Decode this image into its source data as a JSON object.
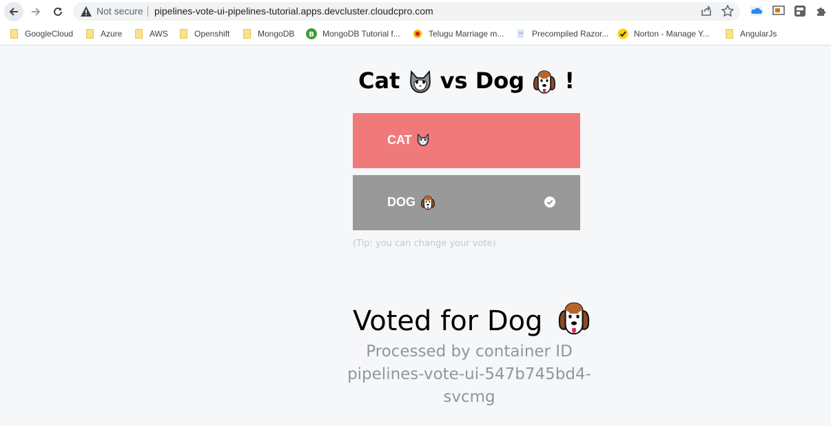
{
  "browser": {
    "security_label": "Not secure",
    "url": "pipelines-vote-ui-pipelines-tutorial.apps.devcluster.cloudcpro.com",
    "icons": [
      "back-arrow-icon",
      "forward-arrow-icon",
      "reload-icon",
      "warning-triangle-icon",
      "share-icon",
      "star-icon",
      "onedrive-icon",
      "cast-icon",
      "extension-icon",
      "puzzle-icon"
    ]
  },
  "bookmarks": [
    {
      "label": "GoogleCloud",
      "icon": "folder-icon"
    },
    {
      "label": "Azure",
      "icon": "folder-icon"
    },
    {
      "label": "AWS",
      "icon": "folder-icon"
    },
    {
      "label": "Openshift",
      "icon": "folder-icon"
    },
    {
      "label": "MongoDB",
      "icon": "folder-icon"
    },
    {
      "label": "MongoDB Tutorial f...",
      "icon": "mongodb-icon"
    },
    {
      "label": "Telugu Marriage m...",
      "icon": "site-icon"
    },
    {
      "label": "Precompiled Razor...",
      "icon": "site-icon"
    },
    {
      "label": "Norton - Manage Y...",
      "icon": "norton-icon"
    },
    {
      "label": "AngularJs",
      "icon": "folder-icon"
    }
  ],
  "page": {
    "title_part1": "Cat",
    "title_part2": "vs Dog",
    "title_part3": "!",
    "cat_button_label": "CAT",
    "dog_button_label": "DOG",
    "selected_option": "dog",
    "tip": "(Tip: you can change your vote)",
    "voted_text": "Voted for Dog",
    "processed_line1": "Processed by container ID",
    "processed_line2": "pipelines-vote-ui-547b745bd4-",
    "processed_line3": "svcmg"
  },
  "colors": {
    "cat_button": "#f07a7a",
    "dog_button": "#999999",
    "tip_text": "#c2c6cb",
    "processed_text": "#8e979f",
    "page_background": "#f6f7f9"
  }
}
